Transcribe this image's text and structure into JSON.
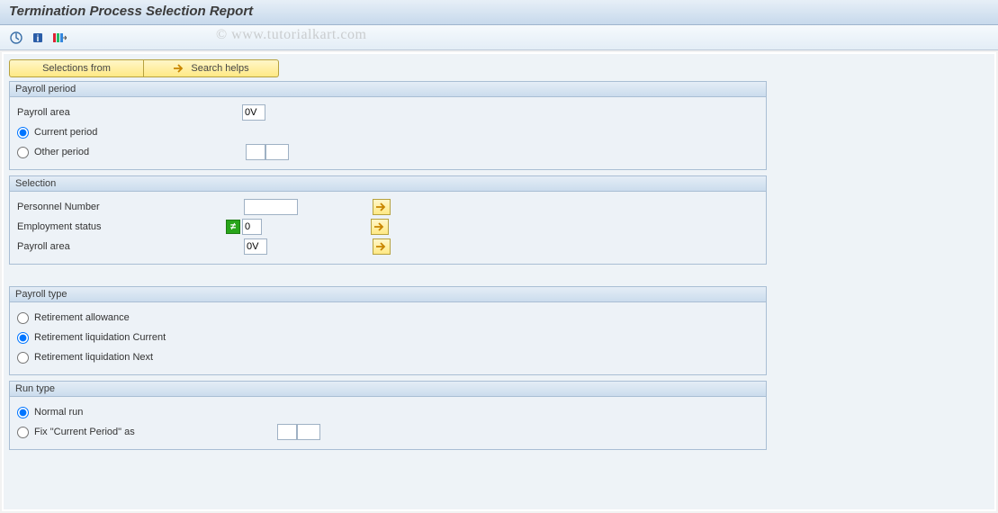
{
  "title": "Termination Process Selection Report",
  "watermark": "© www.tutorialkart.com",
  "toolbar": {
    "execute": "execute",
    "info": "info",
    "variants": "variants"
  },
  "buttons": {
    "selections_from": "Selections from",
    "search_helps": "Search helps"
  },
  "groups": {
    "payroll_period": {
      "title": "Payroll period",
      "payroll_area_label": "Payroll area",
      "payroll_area_value": "0V",
      "current_period": "Current period",
      "other_period": "Other period",
      "other_period_from": "",
      "other_period_to": ""
    },
    "selection": {
      "title": "Selection",
      "personnel_number_label": "Personnel Number",
      "personnel_number_value": "",
      "employment_status_label": "Employment status",
      "employment_status_value": "0",
      "payroll_area_label": "Payroll area",
      "payroll_area_value": "0V",
      "neq_symbol": "≠"
    },
    "payroll_type": {
      "title": "Payroll type",
      "retirement_allowance": "Retirement allowance",
      "retirement_liq_current": "Retirement liquidation Current",
      "retirement_liq_next": "Retirement liquidation Next"
    },
    "run_type": {
      "title": "Run type",
      "normal_run": "Normal run",
      "fix_current_period": "Fix \"Current Period\" as",
      "fix_from": "",
      "fix_to": ""
    }
  }
}
